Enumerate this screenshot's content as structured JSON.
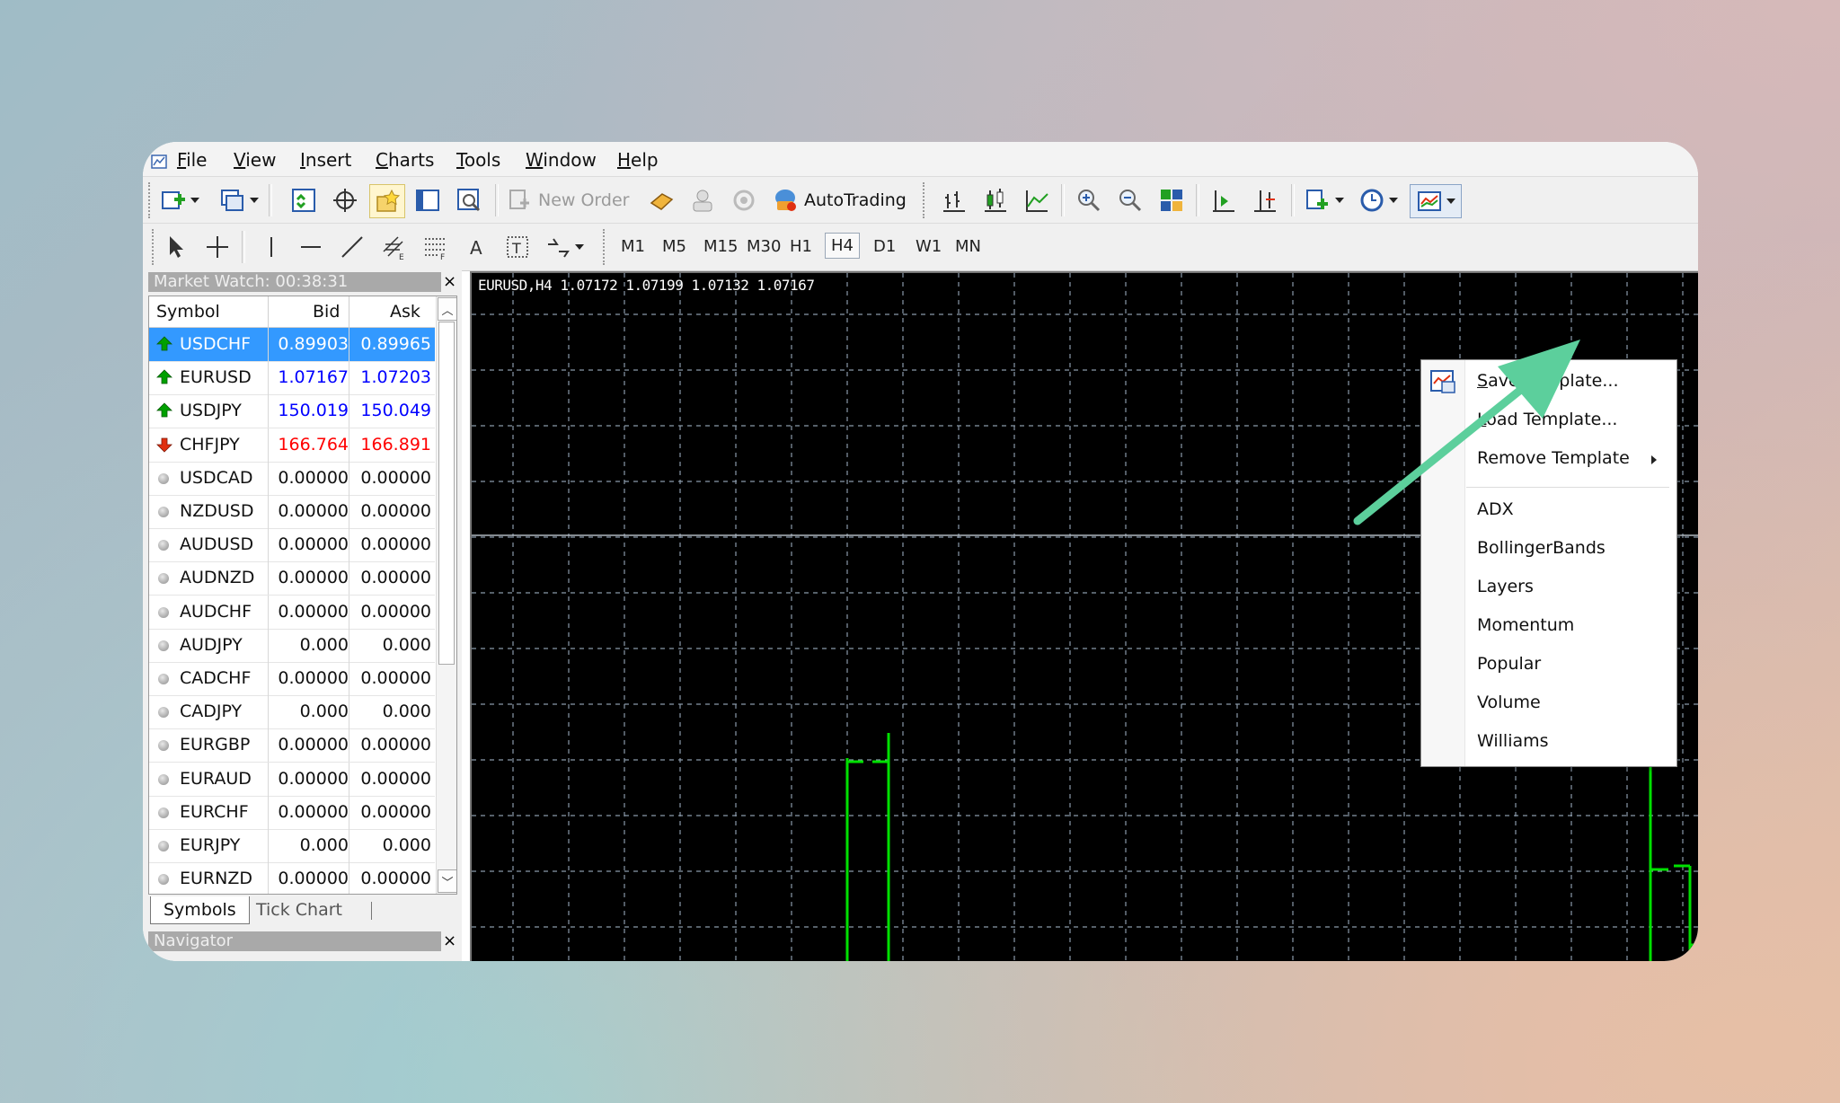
{
  "menu": {
    "items": [
      {
        "label": "File",
        "u": "F"
      },
      {
        "label": "View",
        "u": "V"
      },
      {
        "label": "Insert",
        "u": "I"
      },
      {
        "label": "Charts",
        "u": "C"
      },
      {
        "label": "Tools",
        "u": "T"
      },
      {
        "label": "Window",
        "u": "W"
      },
      {
        "label": "Help",
        "u": "H"
      }
    ]
  },
  "toolbar": {
    "new_order": "New Order",
    "auto_trading": "AutoTrading"
  },
  "timeframes": [
    "M1",
    "M5",
    "M15",
    "M30",
    "H1",
    "H4",
    "D1",
    "W1",
    "MN"
  ],
  "timeframe_active": "H4",
  "market_watch": {
    "title": "Market Watch: 00:38:31",
    "columns": {
      "symbol": "Symbol",
      "bid": "Bid",
      "ask": "Ask"
    },
    "rows": [
      {
        "symbol": "USDCHF",
        "bid": "0.89903",
        "ask": "0.89965",
        "trend": "up",
        "selected": true,
        "color": "#ffffff"
      },
      {
        "symbol": "EURUSD",
        "bid": "1.07167",
        "ask": "1.07203",
        "trend": "up",
        "color": "#0000ff"
      },
      {
        "symbol": "USDJPY",
        "bid": "150.019",
        "ask": "150.049",
        "trend": "up",
        "color": "#0000ff"
      },
      {
        "symbol": "CHFJPY",
        "bid": "166.764",
        "ask": "166.891",
        "trend": "down",
        "color": "#ff0000"
      },
      {
        "symbol": "USDCAD",
        "bid": "0.00000",
        "ask": "0.00000",
        "trend": "none",
        "color": "#111111"
      },
      {
        "symbol": "NZDUSD",
        "bid": "0.00000",
        "ask": "0.00000",
        "trend": "none",
        "color": "#111111"
      },
      {
        "symbol": "AUDUSD",
        "bid": "0.00000",
        "ask": "0.00000",
        "trend": "none",
        "color": "#111111"
      },
      {
        "symbol": "AUDNZD",
        "bid": "0.00000",
        "ask": "0.00000",
        "trend": "none",
        "color": "#111111"
      },
      {
        "symbol": "AUDCHF",
        "bid": "0.00000",
        "ask": "0.00000",
        "trend": "none",
        "color": "#111111"
      },
      {
        "symbol": "AUDJPY",
        "bid": "0.000",
        "ask": "0.000",
        "trend": "none",
        "color": "#111111"
      },
      {
        "symbol": "CADCHF",
        "bid": "0.00000",
        "ask": "0.00000",
        "trend": "none",
        "color": "#111111"
      },
      {
        "symbol": "CADJPY",
        "bid": "0.000",
        "ask": "0.000",
        "trend": "none",
        "color": "#111111"
      },
      {
        "symbol": "EURGBP",
        "bid": "0.00000",
        "ask": "0.00000",
        "trend": "none",
        "color": "#111111"
      },
      {
        "symbol": "EURAUD",
        "bid": "0.00000",
        "ask": "0.00000",
        "trend": "none",
        "color": "#111111"
      },
      {
        "symbol": "EURCHF",
        "bid": "0.00000",
        "ask": "0.00000",
        "trend": "none",
        "color": "#111111"
      },
      {
        "symbol": "EURJPY",
        "bid": "0.000",
        "ask": "0.000",
        "trend": "none",
        "color": "#111111"
      },
      {
        "symbol": "EURNZD",
        "bid": "0.00000",
        "ask": "0.00000",
        "trend": "none",
        "color": "#111111"
      }
    ],
    "tabs": {
      "symbols": "Symbols",
      "tick_chart": "Tick Chart"
    }
  },
  "navigator": {
    "title": "Navigator"
  },
  "chart": {
    "info": "EURUSD,H4  1.07172 1.07199 1.07132 1.07167",
    "background": "#000000",
    "candle_color": "#00e000",
    "grid_color": "#8a9aaa"
  },
  "template_menu": {
    "items": [
      {
        "label": "Save Template...",
        "u": "S"
      },
      {
        "label": "Load Template...",
        "u": "L"
      },
      {
        "label": "Remove Template",
        "submenu": true
      }
    ],
    "templates": [
      "ADX",
      "BollingerBands",
      "Layers",
      "Momentum",
      "Popular",
      "Volume",
      "Williams"
    ]
  },
  "colors": {
    "accent_arrow": "#5ccf9c",
    "selection": "#3399ff",
    "up": "#00a000",
    "down": "#e03010"
  }
}
